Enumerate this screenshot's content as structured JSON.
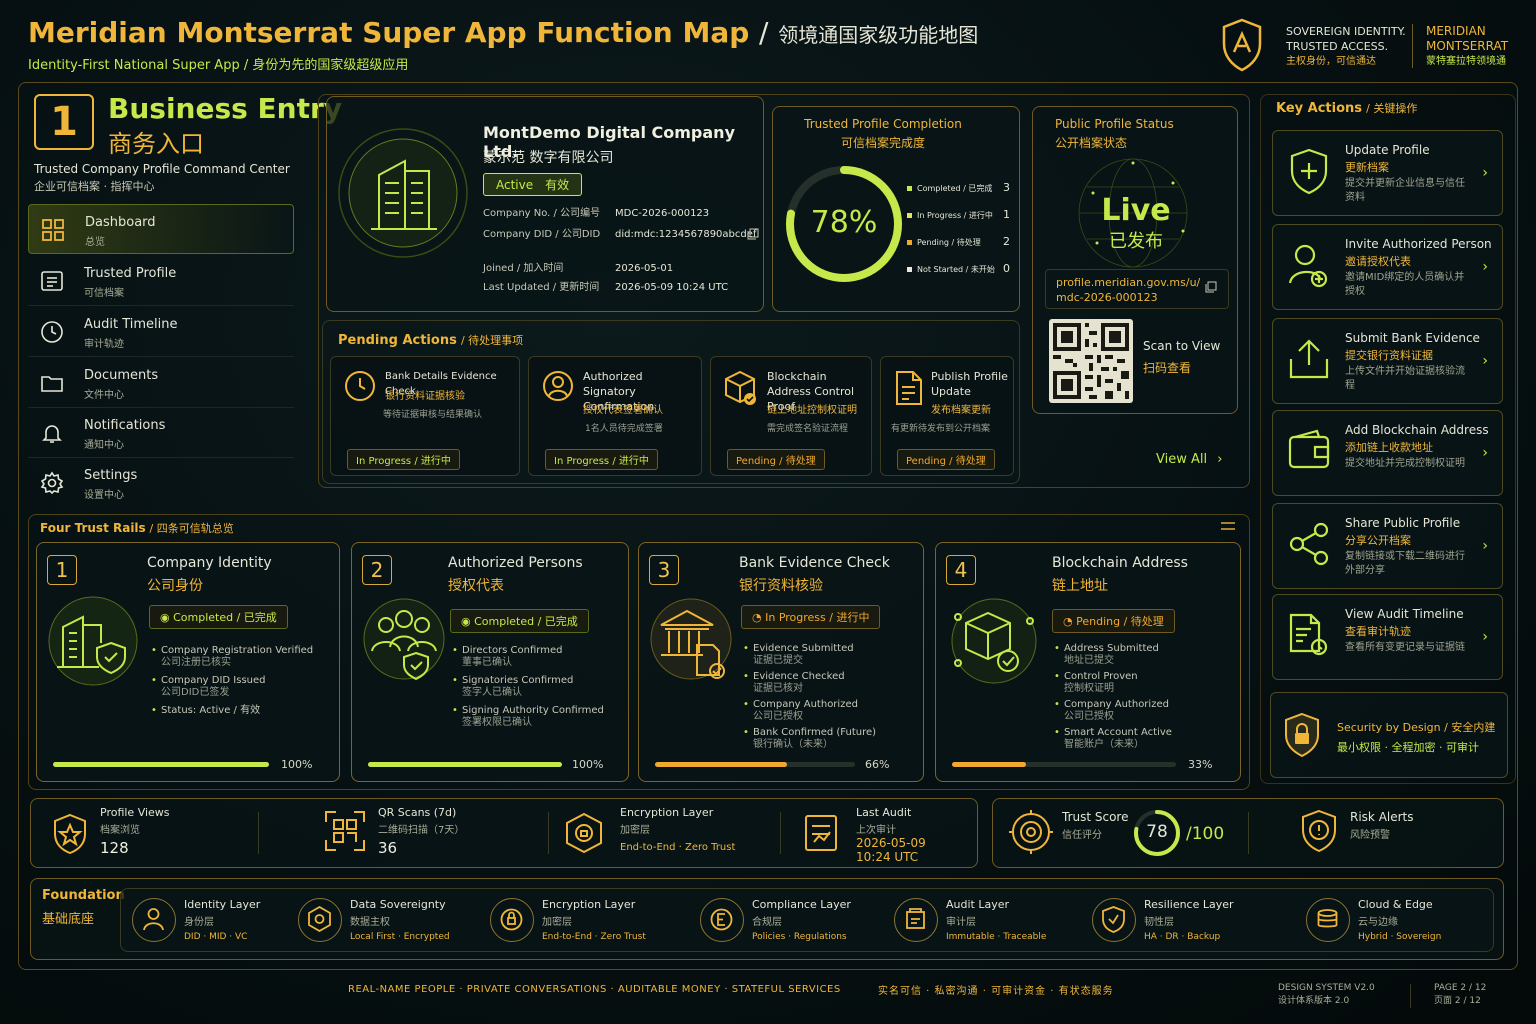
{
  "header": {
    "title_en": "Meridian Montserrat Super App Function Map",
    "title_sep": "/",
    "title_cn": "领境通国家级功能地图",
    "subtitle": "Identity-First National Super App",
    "subtitle_cn": "身份为先的国家级超级应用",
    "tagline_1": "SOVEREIGN IDENTITY.",
    "tagline_2": "TRUSTED ACCESS.",
    "tagline_cn": "主权身份，可信通达",
    "brand_1": "MERIDIAN",
    "brand_2": "MONTSERRAT",
    "brand_cn": "蒙特塞拉特领境通"
  },
  "section": {
    "number": "1",
    "title_en": "Business Entry",
    "title_cn": "商务入口",
    "desc": "Trusted Company Profile Command Center",
    "desc_cn": "企业可信档案 · 指挥中心"
  },
  "nav": [
    {
      "label": "Dashboard",
      "sub": "总览",
      "icon": "grid-icon",
      "active": true
    },
    {
      "label": "Trusted Profile",
      "sub": "可信档案",
      "icon": "profile-icon"
    },
    {
      "label": "Audit Timeline",
      "sub": "审计轨迹",
      "icon": "clock-icon"
    },
    {
      "label": "Documents",
      "sub": "文件中心",
      "icon": "folder-icon"
    },
    {
      "label": "Notifications",
      "sub": "通知中心",
      "icon": "bell-icon"
    },
    {
      "label": "Settings",
      "sub": "设置中心",
      "icon": "gear-icon"
    }
  ],
  "company": {
    "name": "MontDemo Digital Company Ltd.",
    "name_cn": "蒙示范 数字有限公司",
    "status": "Active　有效",
    "rows": [
      {
        "k": "Company No. / 公司编号",
        "v": "MDC-2026-000123"
      },
      {
        "k": "Company DID / 公司DID",
        "v": "did:mdc:1234567890abcdef"
      },
      {
        "k": "Joined / 加入时间",
        "v": "2026-05-01"
      },
      {
        "k": "Last Updated / 更新时间",
        "v": "2026-05-09 10:24 UTC"
      }
    ]
  },
  "completion": {
    "title": "Trusted Profile Completion",
    "title_cn": "可信档案完成度",
    "percent_label": "78%",
    "percent": 78,
    "legend": [
      {
        "label": "Completed / 已完成",
        "count": "3",
        "color": "#c6e84a"
      },
      {
        "label": "In Progress / 进行中",
        "count": "1",
        "color": "#e8e060"
      },
      {
        "label": "Pending / 待处理",
        "count": "2",
        "color": "#f0a830"
      },
      {
        "label": "Not Started / 未开始",
        "count": "0",
        "color": "#e8e8e0"
      }
    ]
  },
  "public_status": {
    "title": "Public Profile Status",
    "title_cn": "公开档案状态",
    "live": "Live",
    "live_cn": "已发布",
    "url_1": "profile.meridian.gov.ms/u/",
    "url_2": "mdc-2026-000123",
    "scan": "Scan to View",
    "scan_cn": "扫码查看"
  },
  "pending": {
    "title": "Pending Actions",
    "title_cn": "/ 待处理事项",
    "view_all": "View All",
    "items": [
      {
        "t1": "Bank Details Evidence Check",
        "t2": "银行资料证据核验",
        "t3": "等待证据审核与结果确认",
        "chip": "In Progress / 进行中",
        "icon": "clock-icon"
      },
      {
        "t1": "Authorized Signatory Confirmation",
        "t2": "授权代表签署确认",
        "t3": "1名人员待完成签署",
        "chip": "In Progress / 进行中",
        "icon": "person-icon"
      },
      {
        "t1": "Blockchain Address Control Proof",
        "t2": "链上地址控制权证明",
        "t3": "需完成签名验证流程",
        "chip": "Pending / 待处理",
        "icon": "cube-icon"
      },
      {
        "t1": "Publish Profile Update",
        "t2": "发布档案更新",
        "t3": "有更新待发布到公开档案",
        "chip": "Pending / 待处理",
        "icon": "document-icon"
      }
    ]
  },
  "rails": {
    "title": "Four Trust Rails",
    "title_cn": "/ 四条可信轨总览",
    "items": [
      {
        "n": "1",
        "t1": "Company Identity",
        "t2": "公司身份",
        "status": "Completed / 已完成",
        "checks": [
          [
            "Company Registration Verified",
            "公司注册已核实"
          ],
          [
            "Company DID Issued",
            "公司DID已签发"
          ],
          [
            "Status: Active / 有效",
            ""
          ]
        ],
        "progress": 100,
        "pct": "100%",
        "color": "#c6e84a"
      },
      {
        "n": "2",
        "t1": "Authorized Persons",
        "t2": "授权代表",
        "status": "Completed / 已完成",
        "checks": [
          [
            "Directors Confirmed",
            "董事已确认"
          ],
          [
            "Signatories Confirmed",
            "签字人已确认"
          ],
          [
            "Signing Authority Confirmed",
            "签署权限已确认"
          ]
        ],
        "progress": 100,
        "pct": "100%",
        "color": "#c6e84a"
      },
      {
        "n": "3",
        "t1": "Bank Evidence Check",
        "t2": "银行资料核验",
        "status": "In Progress / 进行中",
        "checks": [
          [
            "Evidence Submitted",
            "证据已提交"
          ],
          [
            "Evidence Checked",
            "证据已核对"
          ],
          [
            "Company Authorized",
            "公司已授权"
          ],
          [
            "Bank Confirmed (Future)",
            "银行确认（未来）"
          ]
        ],
        "progress": 66,
        "pct": "66%",
        "color": "#f0a830"
      },
      {
        "n": "4",
        "t1": "Blockchain Address",
        "t2": "链上地址",
        "status": "Pending / 待处理",
        "checks": [
          [
            "Address Submitted",
            "地址已提交"
          ],
          [
            "Control Proven",
            "控制权证明"
          ],
          [
            "Company Authorized",
            "公司已授权"
          ],
          [
            "Smart Account Active",
            "智能账户（未来）"
          ]
        ],
        "progress": 33,
        "pct": "33%",
        "color": "#f0a830"
      }
    ]
  },
  "key_actions": {
    "title": "Key Actions",
    "title_cn": "/ 关键操作",
    "items": [
      {
        "t1": "Update Profile",
        "t2": "更新档案",
        "t3": "提交并更新企业信息与信任资料",
        "icon": "shield-plus-icon"
      },
      {
        "t1": "Invite Authorized Person",
        "t2": "邀请授权代表",
        "t3": "邀请MID绑定的人员确认并授权",
        "icon": "add-person-icon"
      },
      {
        "t1": "Submit Bank Evidence",
        "t2": "提交银行资料证据",
        "t3": "上传文件并开始证据核验流程",
        "icon": "upload-icon"
      },
      {
        "t1": "Add Blockchain Address",
        "t2": "添加链上收款地址",
        "t3": "提交地址并完成控制权证明",
        "icon": "wallet-icon"
      },
      {
        "t1": "Share Public Profile",
        "t2": "分享公开档案",
        "t3": "复制链接或下载二维码进行外部分享",
        "icon": "share-icon"
      },
      {
        "t1": "View Audit Timeline",
        "t2": "查看审计轨迹",
        "t3": "查看所有变更记录与证据链",
        "icon": "audit-icon"
      }
    ],
    "security": "Security by Design / 安全内建",
    "security_sub": "最小权限 · 全程加密 · 可审计"
  },
  "stats": {
    "profile_views": {
      "t1": "Profile Views",
      "t2": "档案浏览",
      "v": "128"
    },
    "qr_scans": {
      "t1": "QR Scans (7d)",
      "t2": "二维码扫描（7天）",
      "v": "36"
    },
    "encryption": {
      "t1": "Encryption Layer",
      "t2": "加密层",
      "v": "End-to-End · Zero Trust"
    },
    "last_audit": {
      "t1": "Last Audit",
      "t2": "上次审计",
      "v1": "2026-05-09",
      "v2": "10:24 UTC"
    },
    "trust_score": {
      "t1": "Trust Score",
      "t2": "信任评分",
      "v": "78",
      "max": "/100",
      "score": 78
    },
    "risk": {
      "t1": "Risk Alerts",
      "t2": "风险预警"
    }
  },
  "foundation": {
    "title": "Foundation",
    "title_cn": "基础底座",
    "items": [
      {
        "t1": "Identity Layer",
        "t2": "身份层",
        "t3": "DID · MID · VC",
        "icon": "identity-icon"
      },
      {
        "t1": "Data Sovereignty",
        "t2": "数据主权",
        "t3": "Local First · Encrypted",
        "icon": "data-icon"
      },
      {
        "t1": "Encryption Layer",
        "t2": "加密层",
        "t3": "End-to-End · Zero Trust",
        "icon": "lock-icon"
      },
      {
        "t1": "Compliance Layer",
        "t2": "合规层",
        "t3": "Policies · Regulations",
        "icon": "compliance-icon"
      },
      {
        "t1": "Audit Layer",
        "t2": "审计层",
        "t3": "Immutable · Traceable",
        "icon": "audit-layer-icon"
      },
      {
        "t1": "Resilience Layer",
        "t2": "韧性层",
        "t3": "HA · DR · Backup",
        "icon": "resilience-icon"
      },
      {
        "t1": "Cloud & Edge",
        "t2": "云与边缘",
        "t3": "Hybrid · Sovereign",
        "icon": "cloud-icon"
      }
    ]
  },
  "footer": {
    "slogan": "REAL-NAME PEOPLE · PRIVATE CONVERSATIONS · AUDITABLE MONEY · STATEFUL SERVICES",
    "slogan_cn": "实名可信 · 私密沟通 · 可审计资金 · 有状态服务",
    "design": "DESIGN SYSTEM V2.0",
    "design_cn": "设计体系版本 2.0",
    "page": "PAGE 2 / 12",
    "page_cn": "页面 2 / 12"
  },
  "colors": {
    "gold": "#f0b63a",
    "lime": "#c6e84a",
    "orange": "#f0a830",
    "bg": "#050b0d"
  }
}
